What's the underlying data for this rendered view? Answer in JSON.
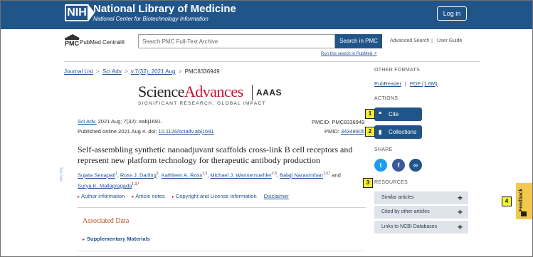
{
  "header": {
    "logo": "NIH",
    "title": "National Library of Medicine",
    "subtitle": "National Center for Biotechnology Information",
    "login_label": "Log in"
  },
  "search": {
    "logo_mark": "PMC",
    "logo_text": "PubMed Central®",
    "placeholder": "Search PMC Full-Text Archive",
    "button_label": "Search in PMC",
    "advanced_label": "Advanced Search",
    "separator": "|",
    "guide_label": "User Guide",
    "run_pubmed_label": "Run this search in PubMed ↗"
  },
  "breadcrumb": {
    "items": [
      "Journal List",
      "Sci Adv",
      "v.7(32); 2021 Aug"
    ],
    "current": "PMC8336949",
    "separator": ">"
  },
  "journal_logo": {
    "science": "Science",
    "advances": "Advances",
    "publisher": "AAAS",
    "tagline": "SIGNIFICANT RESEARCH, GLOBAL IMPACT"
  },
  "citation": {
    "journal_link": "Sci Adv.",
    "details": "2021 Aug; 7(32): eabj1691.",
    "published_prefix": "Published online 2021 Aug 4. doi:",
    "doi": "10.1126/sciadv.abj1691",
    "pmcid": "PMCID: PMC8336949",
    "pmid_label": "PMID:",
    "pmid": "34348905",
    "side_label": "Sci Adv"
  },
  "article": {
    "title": "Self-assembling synthetic nanoadjuvant scaffolds cross-link B cell receptors and represent new platform technology for therapeutic antibody production",
    "authors": [
      {
        "name": "Sujata Senapati",
        "sup": "1"
      },
      {
        "name": "Ross J. Darling",
        "sup": "2"
      },
      {
        "name": "Kathleen A. Ross",
        "sup": "1,3"
      },
      {
        "name": "Michael J. Wannemuehler",
        "sup": "2,3"
      },
      {
        "name": "Balaji Narasimhan",
        "sup": "1,3,*"
      },
      {
        "name": "Surya K. Mallapragada",
        "sup": "1,3,*"
      }
    ],
    "and_word": "and",
    "info_links": [
      "Author information",
      "Article notes",
      "Copyright and License information"
    ],
    "disclaimer": "Disclaimer",
    "associated_data_title": "Associated Data",
    "supplementary_label": "Supplementary Materials"
  },
  "sidebar": {
    "other_formats_title": "OTHER FORMATS",
    "formats": [
      "PubReader",
      "PDF (1.6M)"
    ],
    "actions_title": "ACTIONS",
    "cite_label": "Cite",
    "collections_label": "Collections",
    "share_title": "SHARE",
    "share_icons": [
      "twitter-icon",
      "facebook-icon",
      "link-icon"
    ],
    "share_glyphs": [
      "t",
      "f",
      "∞"
    ],
    "resources_title": "RESOURCES",
    "resources": [
      "Similar articles",
      "Cited by other articles",
      "Links to NCBI Databases"
    ],
    "cite_icon_glyph": "❝",
    "collections_icon_glyph": "▮",
    "plus_glyph": "+"
  },
  "feedback": {
    "label": "Feedback"
  },
  "markers": [
    "1",
    "2",
    "3",
    "4"
  ],
  "colors": {
    "header_bg": "#20558a",
    "button_blue": "#20558a",
    "link_blue": "#205493",
    "science_red": "#c8102e",
    "associated_orange": "#b25121",
    "resource_bg": "#dfe4ea",
    "feedback_yellow": "#f2c94c",
    "marker_yellow": "#f5ee3b",
    "twitter": "#1d9bf0",
    "facebook": "#3b5998",
    "link_share": "#20558a"
  }
}
